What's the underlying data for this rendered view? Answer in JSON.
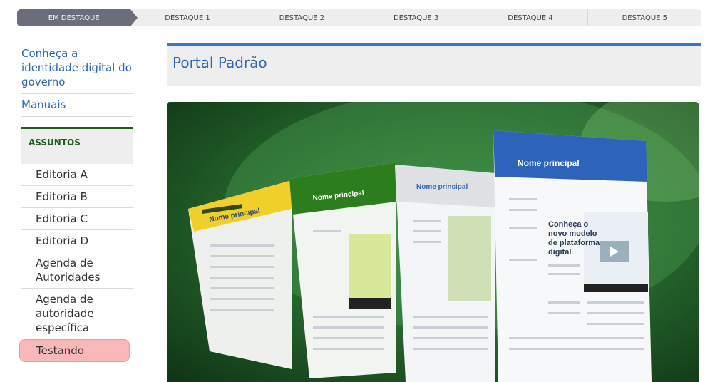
{
  "tabs": [
    {
      "label": "EM DESTAQUE",
      "active": true
    },
    {
      "label": "DESTAQUE 1"
    },
    {
      "label": "DESTAQUE 2"
    },
    {
      "label": "DESTAQUE 3"
    },
    {
      "label": "DESTAQUE 4"
    },
    {
      "label": "DESTAQUE 5"
    }
  ],
  "sidebar": {
    "links": [
      "Conheça a identidade digital do governo",
      "Manuais"
    ],
    "assuntos_title": "ASSUNTOS",
    "assuntos_items": [
      "Editoria A",
      "Editoria B",
      "Editoria C",
      "Editoria D",
      "Agenda de Autoridades",
      "Agenda de autoridade específica",
      "Testando"
    ]
  },
  "main": {
    "title": "Portal Padrão",
    "banner": {
      "mock_title": "Nome principal",
      "mock_headline": "Conheça o novo modelo de plataforma digital"
    }
  },
  "colors": {
    "link": "#2c66b4",
    "assuntos_accent": "#1e5c1b",
    "highlight": "#f9b7b7"
  }
}
